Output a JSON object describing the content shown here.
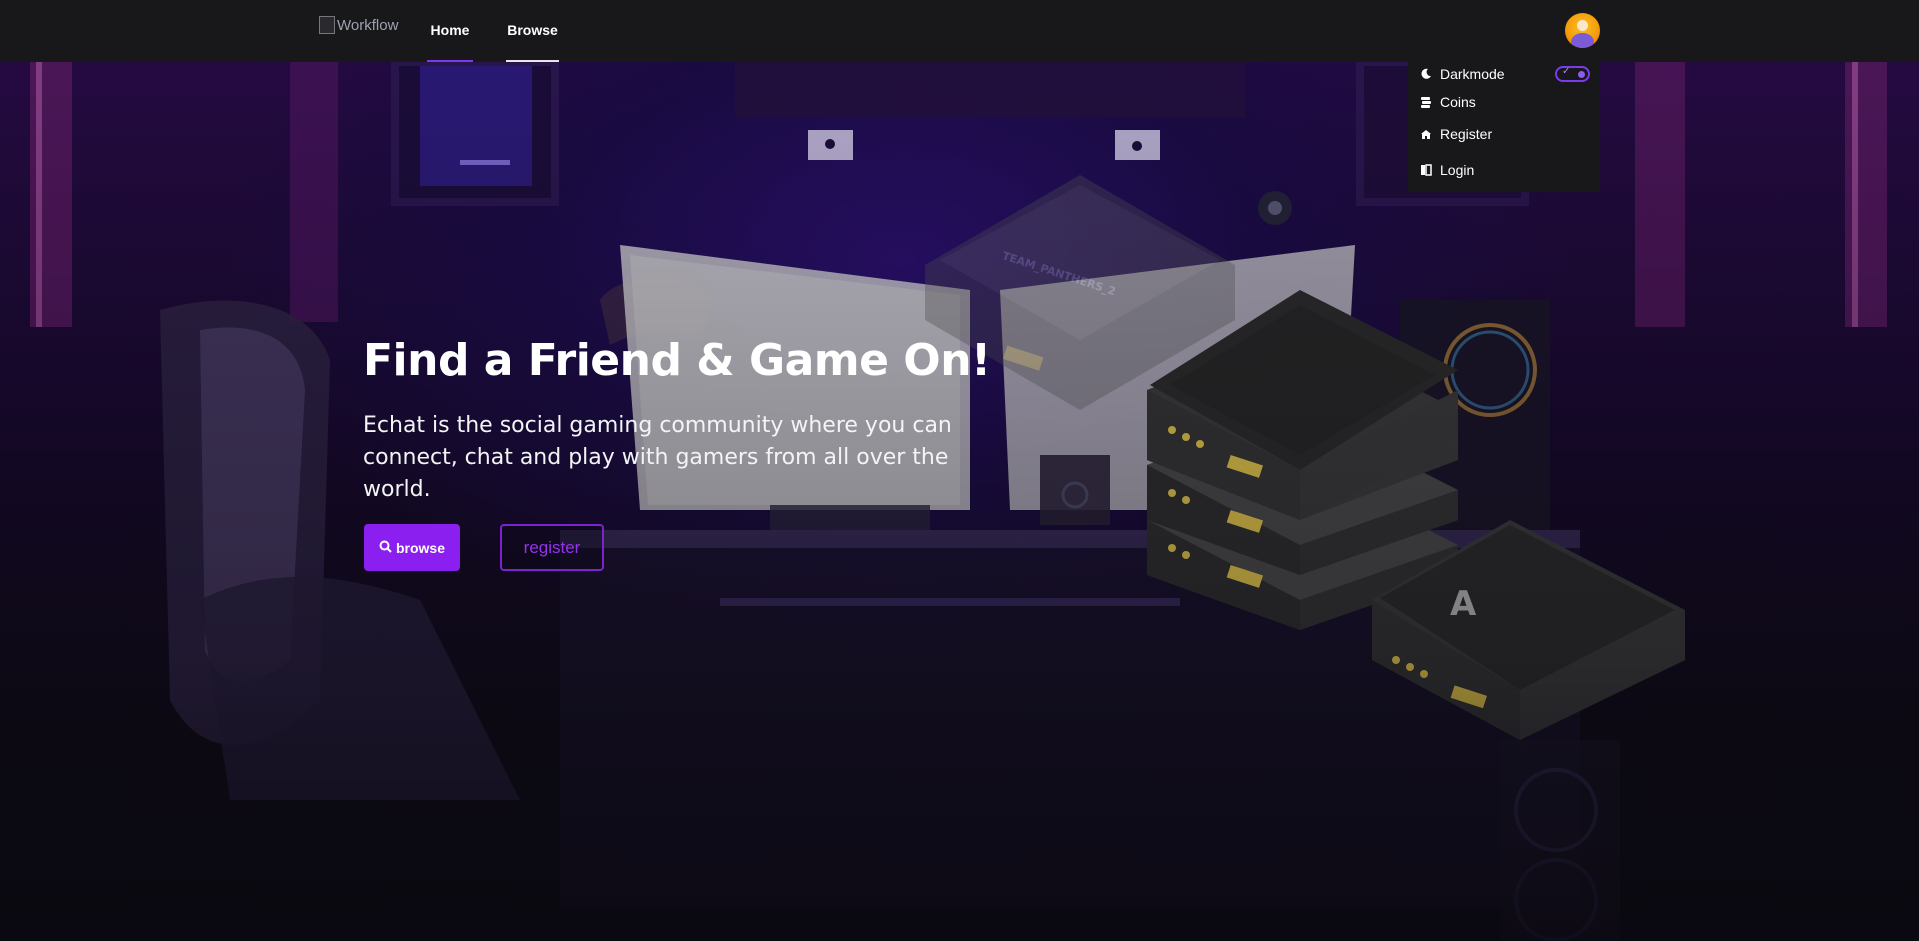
{
  "navbar": {
    "logo_alt": "Workflow",
    "links": [
      {
        "label": "Home",
        "active": true
      },
      {
        "label": "Browse",
        "active": false
      }
    ]
  },
  "dropdown": {
    "darkmode_label": "Darkmode",
    "darkmode_on": true,
    "coins_label": "Coins",
    "register_label": "Register",
    "login_label": "Login"
  },
  "hero": {
    "title": "Find a Friend & Game On!",
    "text": "Echat is the social gaming community where you can connect, chat and play with gamers from all over the world.",
    "browse_button": "browse",
    "register_button": "register"
  },
  "icons": {
    "moon": "moon-icon",
    "coins": "coins-icon",
    "register": "register-icon",
    "login": "login-icon",
    "search": "search-icon"
  },
  "colors": {
    "accent": "#7e22ce",
    "navbar_bg": "#18181b",
    "server_stripe": "#e5c84a"
  }
}
